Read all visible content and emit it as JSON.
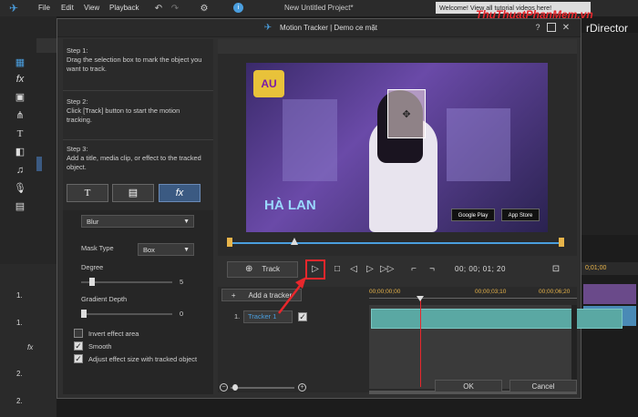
{
  "app": {
    "menu": [
      "File",
      "Edit",
      "View",
      "Playback"
    ],
    "project_title": "New Untitled Project*",
    "welcome_banner": "Welcome! View all tutorial videos here!",
    "brand": "rDirector",
    "watermark": "ThuThuatPhanMem.vn",
    "timeline_ruler": [
      "0;01;00"
    ],
    "track_labels": [
      "1.",
      "1.",
      "2.",
      "2."
    ]
  },
  "dialog": {
    "title": "Motion Tracker | Demo ce mặt",
    "steps": [
      {
        "heading": "Step 1:",
        "text": "Drag the selection box to mark the object you want to track."
      },
      {
        "heading": "Step 2:",
        "text": "Click [Track] button to start the motion tracking."
      },
      {
        "heading": "Step 3:",
        "text": "Add a title, media clip, or effect to the tracked object."
      }
    ],
    "effect_buttons": [
      "T",
      "▤",
      "fx"
    ],
    "effect_type": "Blur",
    "mask_type_label": "Mask Type",
    "mask_type_value": "Box",
    "degree_label": "Degree",
    "degree_value": "5",
    "degree_level": 0.1,
    "gradient_label": "Gradient Depth",
    "gradient_value": "0",
    "gradient_level": 0.0,
    "options": [
      {
        "label": "Invert effect area",
        "checked": false
      },
      {
        "label": "Smooth",
        "checked": true
      },
      {
        "label": "Adjust effect size with tracked object",
        "checked": true
      }
    ],
    "track_button": "Track",
    "timecode": "00; 00; 01; 20",
    "add_tracker": "Add a tracker",
    "tracker_name": "Tracker 1",
    "tracker_number": "1.",
    "ruler_marks": [
      "00;00;00;00",
      "00;00;03;10",
      "00;00;06;20"
    ],
    "ok": "OK",
    "cancel": "Cancel",
    "preview_texts": {
      "logo": "AU",
      "hala": "HÀ LAN",
      "google_play": "Google Play",
      "app_store": "App Store"
    },
    "colors": {
      "accent": "#e8272c",
      "highlight": "#4a9ede",
      "clip": "#5aa8a3",
      "scrubber": "#e8b44a"
    }
  }
}
